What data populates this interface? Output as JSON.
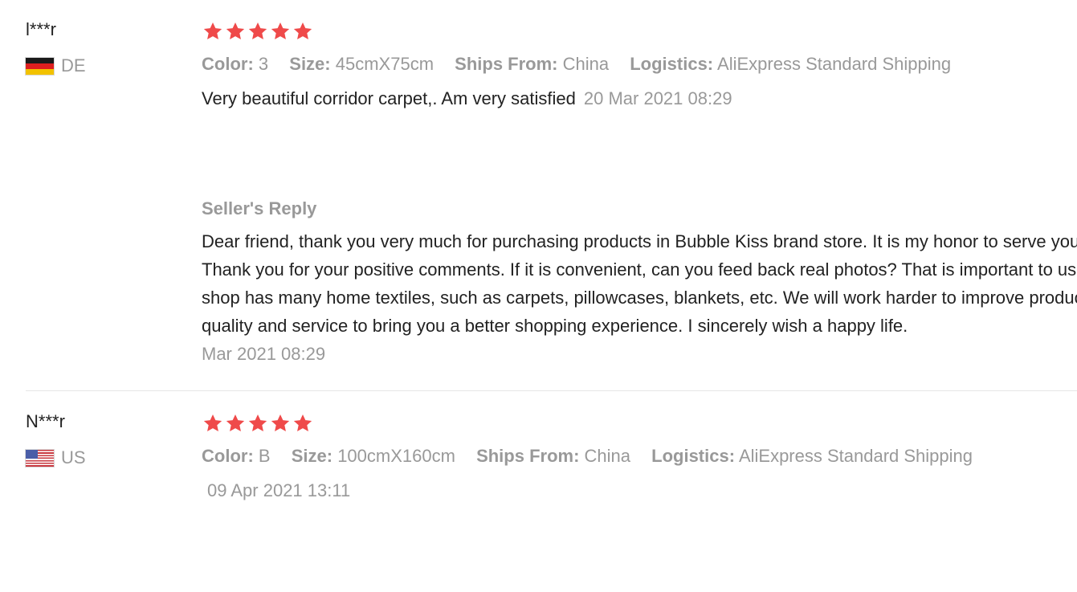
{
  "colors": {
    "star": "#ef4a4a",
    "muted_text": "#999999",
    "body_text": "#222222",
    "divider": "#e6e6e6"
  },
  "reviews": [
    {
      "user": "l***r",
      "country_code": "DE",
      "flag_icon": "germany-flag-icon",
      "rating": 5,
      "attributes": [
        {
          "label": "Color:",
          "value": "3"
        },
        {
          "label": "Size:",
          "value": "45cmX75cm"
        },
        {
          "label": "Ships From:",
          "value": "China"
        },
        {
          "label": "Logistics:",
          "value": "AliExpress Standard Shipping"
        }
      ],
      "text": "Very beautiful corridor carpet,. Am very satisfied",
      "date": "20 Mar 2021 08:29",
      "seller_reply": {
        "title": "Seller's Reply",
        "text": "Dear friend, thank you very much for purchasing products in Bubble Kiss brand store. It is my honor to serve you. Thank you for your positive comments. If it is convenient, can you feed back real photos? That is important to us. Our shop has many home textiles, such as carpets, pillowcases, blankets, etc. We will work harder to improve product quality and service to bring you a better shopping experience. I sincerely wish a happy life.",
        "date": "Mar 2021 08:29"
      }
    },
    {
      "user": "N***r",
      "country_code": "US",
      "flag_icon": "usa-flag-icon",
      "rating": 5,
      "attributes": [
        {
          "label": "Color:",
          "value": "B"
        },
        {
          "label": "Size:",
          "value": "100cmX160cm"
        },
        {
          "label": "Ships From:",
          "value": "China"
        },
        {
          "label": "Logistics:",
          "value": "AliExpress Standard Shipping"
        }
      ],
      "text": "",
      "date": "09 Apr 2021 13:11"
    }
  ]
}
